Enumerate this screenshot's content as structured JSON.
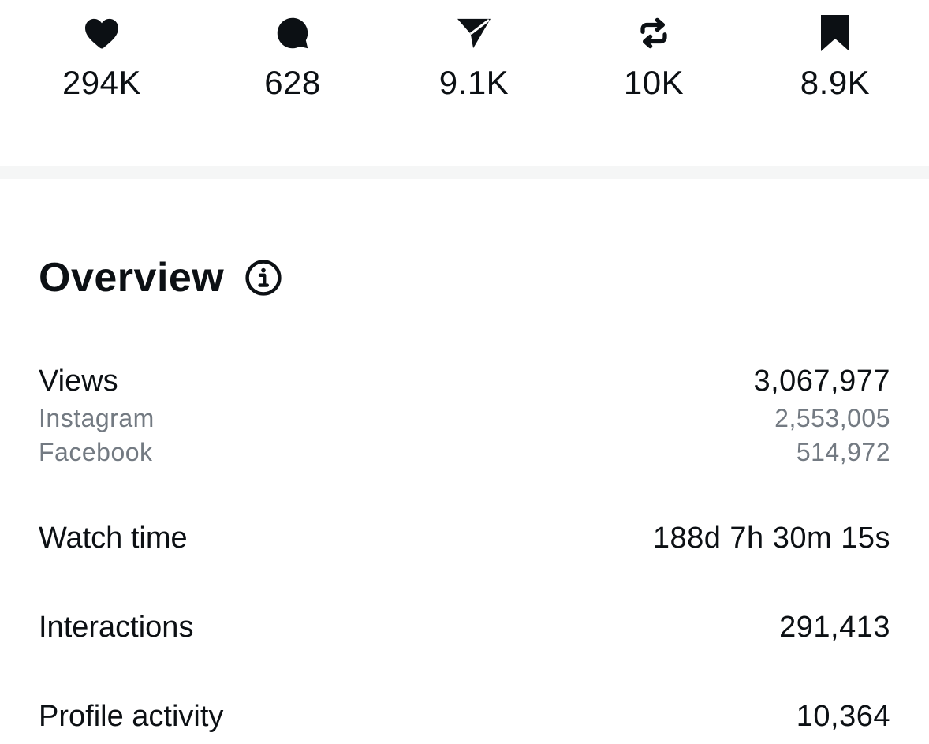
{
  "engagement": {
    "likes": {
      "icon": "heart-icon",
      "count": "294K"
    },
    "comments": {
      "icon": "comment-bubble-icon",
      "count": "628"
    },
    "shares": {
      "icon": "send-paper-plane-icon",
      "count": "9.1K"
    },
    "reposts": {
      "icon": "repost-icon",
      "count": "10K"
    },
    "saves": {
      "icon": "bookmark-icon",
      "count": "8.9K"
    }
  },
  "overview": {
    "title": "Overview",
    "info_icon": "info-icon",
    "views": {
      "label": "Views",
      "value": "3,067,977",
      "breakdown": [
        {
          "label": "Instagram",
          "value": "2,553,005"
        },
        {
          "label": "Facebook",
          "value": "514,972"
        }
      ]
    },
    "watch_time": {
      "label": "Watch time",
      "value": "188d 7h 30m 15s"
    },
    "interactions": {
      "label": "Interactions",
      "value": "291,413"
    },
    "profile_activity": {
      "label": "Profile activity",
      "value": "10,364"
    }
  },
  "colors": {
    "text_primary": "#0c1014",
    "text_secondary": "#737a82",
    "divider": "#f5f6f6",
    "background": "#ffffff"
  }
}
